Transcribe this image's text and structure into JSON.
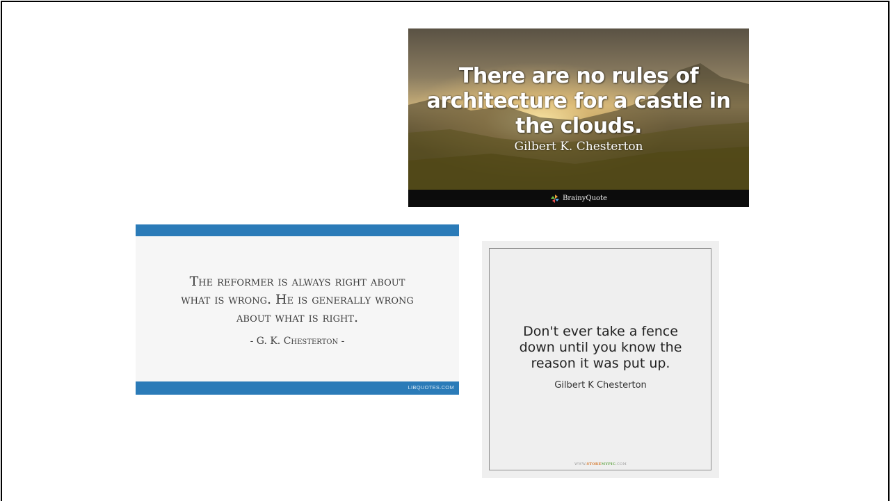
{
  "quotes": [
    {
      "lines": [
        "There are no rules of",
        "architecture for a castle in",
        "the clouds."
      ],
      "author": "Gilbert K. Chesterton",
      "brand": "BrainyQuote"
    },
    {
      "lines": [
        "The reformer is always right about",
        "what is wrong. He is generally wrong",
        "about what is right."
      ],
      "author": "- G. K. Chesterton -",
      "site": "LIBQUOTES.COM"
    },
    {
      "lines": [
        "Don't ever take a fence",
        "down until you know the",
        "reason it was put up."
      ],
      "author": "Gilbert K Chesterton",
      "site_prefix": "WWW.",
      "site_brand_a": "STORE",
      "site_brand_b": "MYPIC",
      "site_suffix": ".COM"
    }
  ],
  "colors": {
    "libquotes_blue": "#2b7bb8",
    "storemypic_bg": "#efefef"
  }
}
